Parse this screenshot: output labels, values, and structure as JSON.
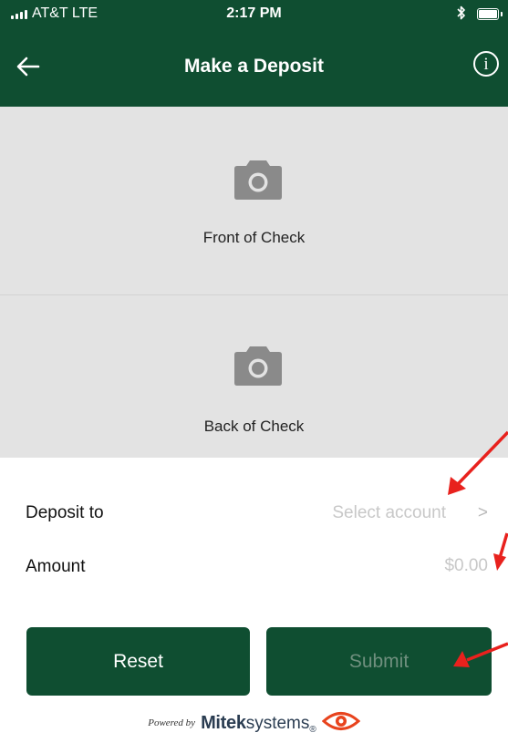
{
  "status_bar": {
    "carrier": "AT&T  LTE",
    "time": "2:17 PM"
  },
  "header": {
    "title": "Make a Deposit",
    "back_icon": "arrow-left-icon",
    "info_icon": "info-icon",
    "info_glyph": "i"
  },
  "checks": {
    "front_label": "Front of Check",
    "back_label": "Back of Check",
    "icon": "camera-icon"
  },
  "form": {
    "deposit_label": "Deposit to",
    "deposit_value": "Select account",
    "deposit_chevron": ">",
    "amount_label": "Amount",
    "amount_placeholder": "$0.00"
  },
  "buttons": {
    "reset_label": "Reset",
    "submit_label": "Submit"
  },
  "footer": {
    "powered_by": "Powered by",
    "brand_strong": "Mitek",
    "brand_light": "systems",
    "brand_mark": "®"
  },
  "colors": {
    "brand_green": "#0f4e31",
    "panel_gray": "#e3e3e3",
    "placeholder_gray": "#c8c8c8",
    "disabled_text": "#6f8f7e",
    "annotation_red": "#e8211d"
  }
}
